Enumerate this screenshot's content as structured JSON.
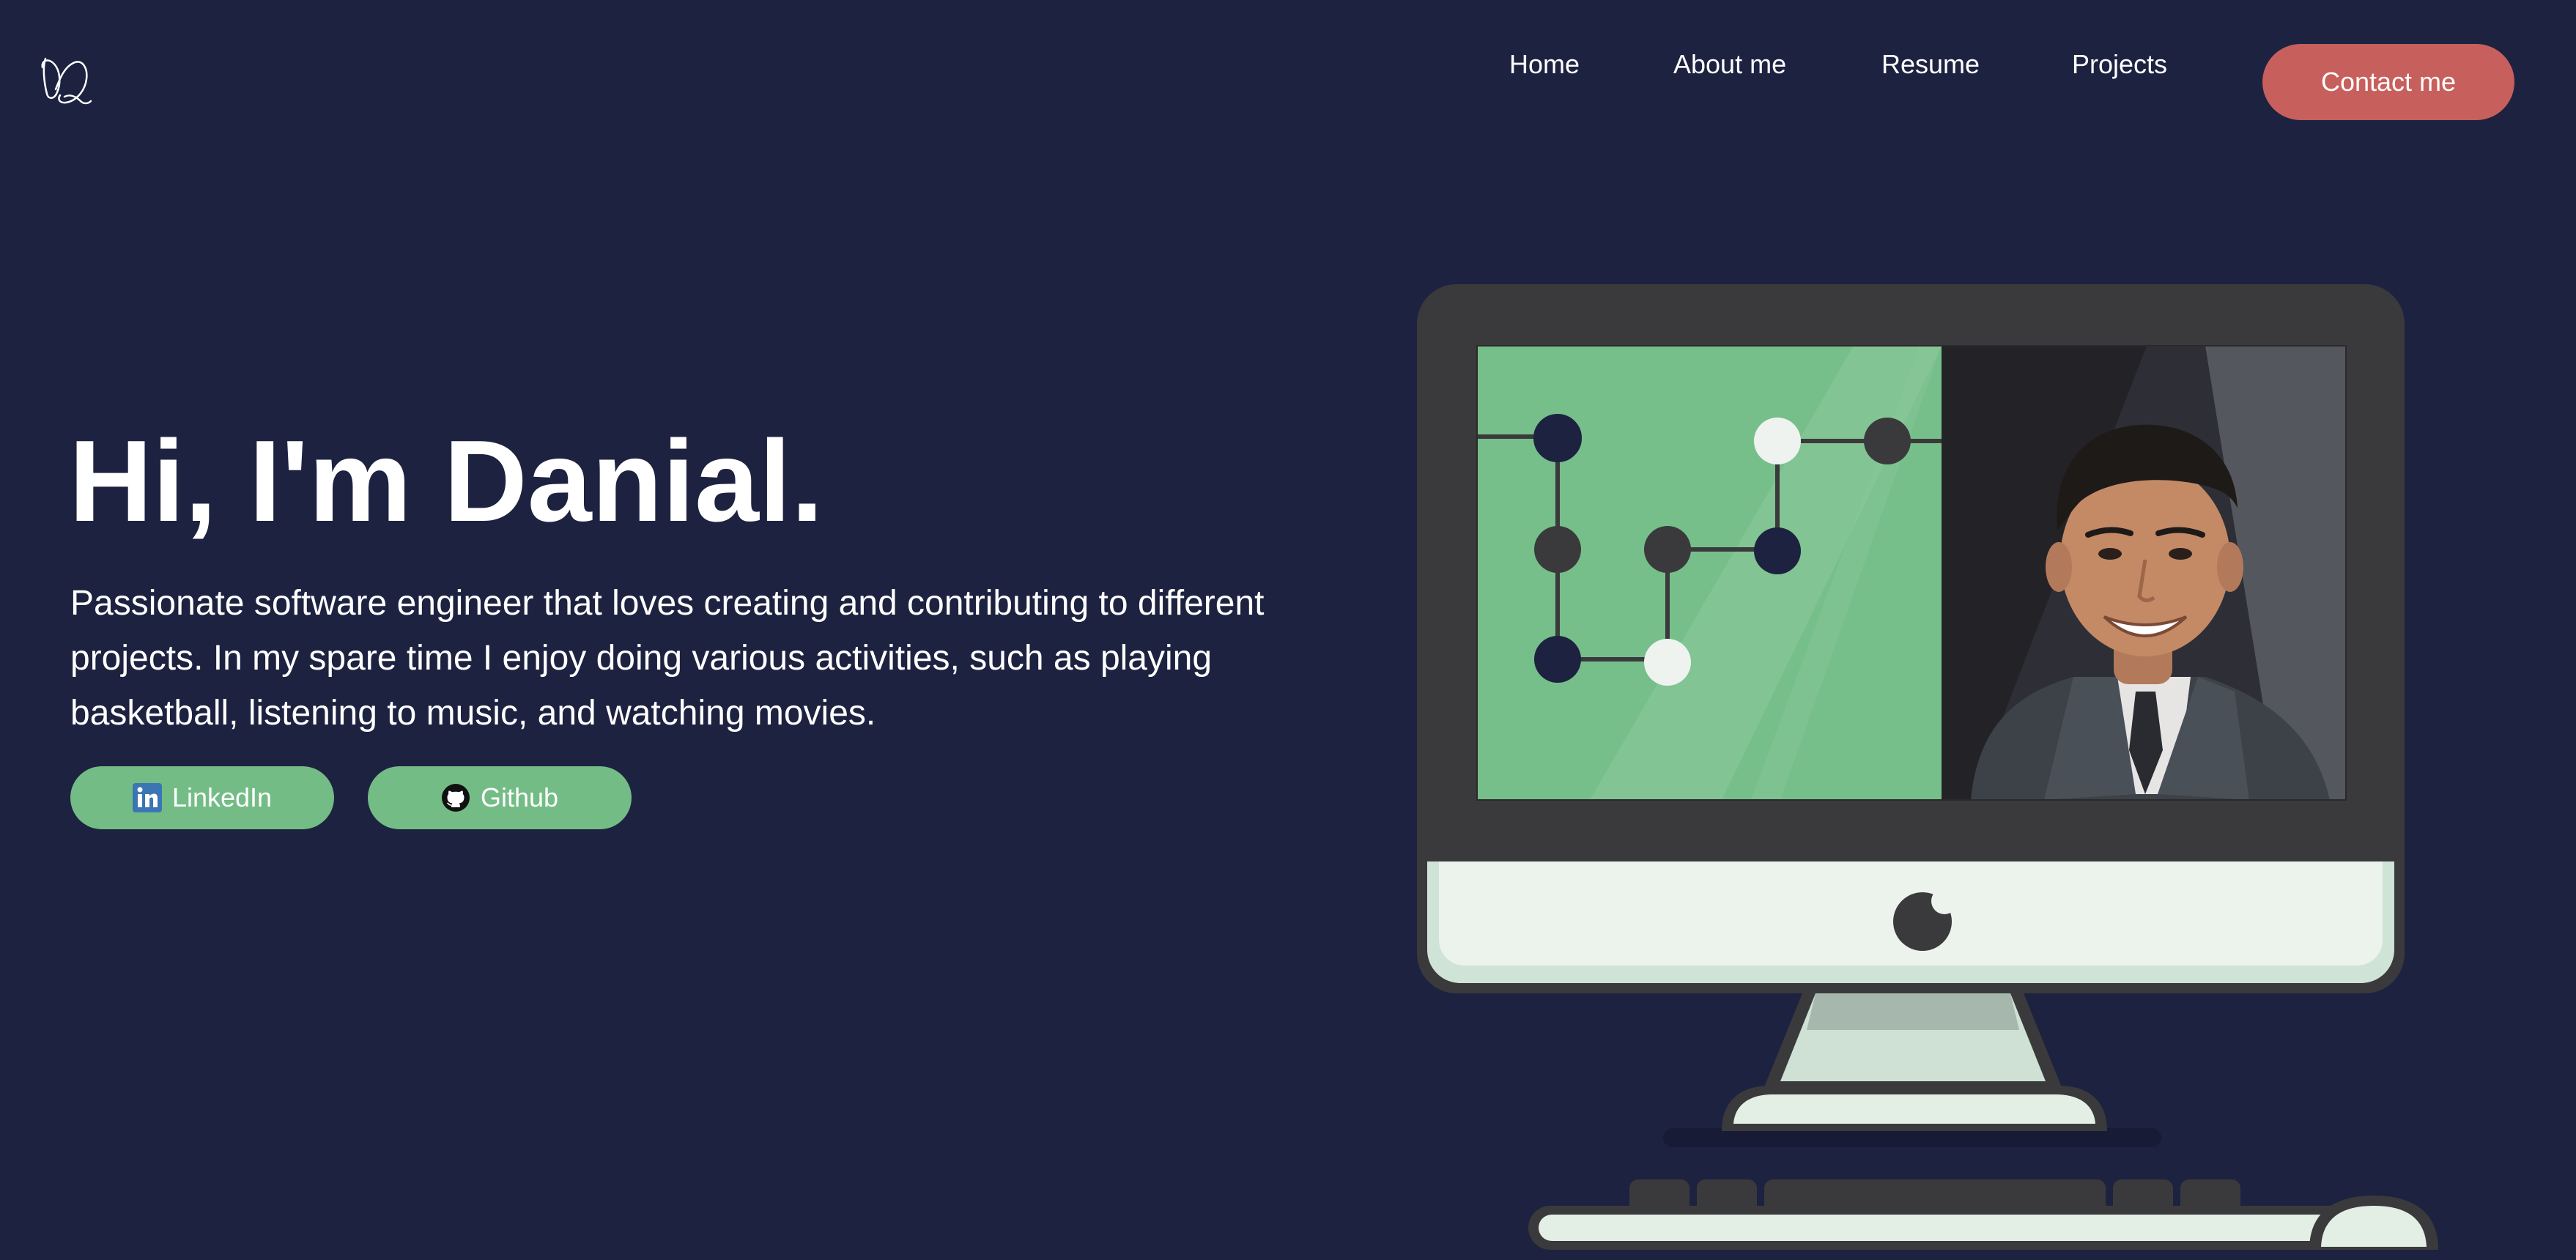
{
  "header": {
    "logo_text": "DD",
    "nav": {
      "home": "Home",
      "about": "About me",
      "resume": "Resume",
      "projects": "Projects"
    },
    "contact_label": "Contact me"
  },
  "hero": {
    "title": "Hi, I'm Danial.",
    "description": "Passionate software engineer that loves creating and contributing to different projects. In my spare time I enjoy doing various activities, such as playing basketball, listening to music, and watching movies.",
    "buttons": {
      "linkedin": "LinkedIn",
      "github": "Github"
    }
  },
  "icons": {
    "logo": "signature-logo-icon",
    "linkedin": "linkedin-icon",
    "github": "github-icon",
    "apple": "apple-logo-icon"
  },
  "colors": {
    "background": "#1d2240",
    "accent": "#c75f5c",
    "pill": "#74bc86",
    "text": "#ffffff"
  }
}
